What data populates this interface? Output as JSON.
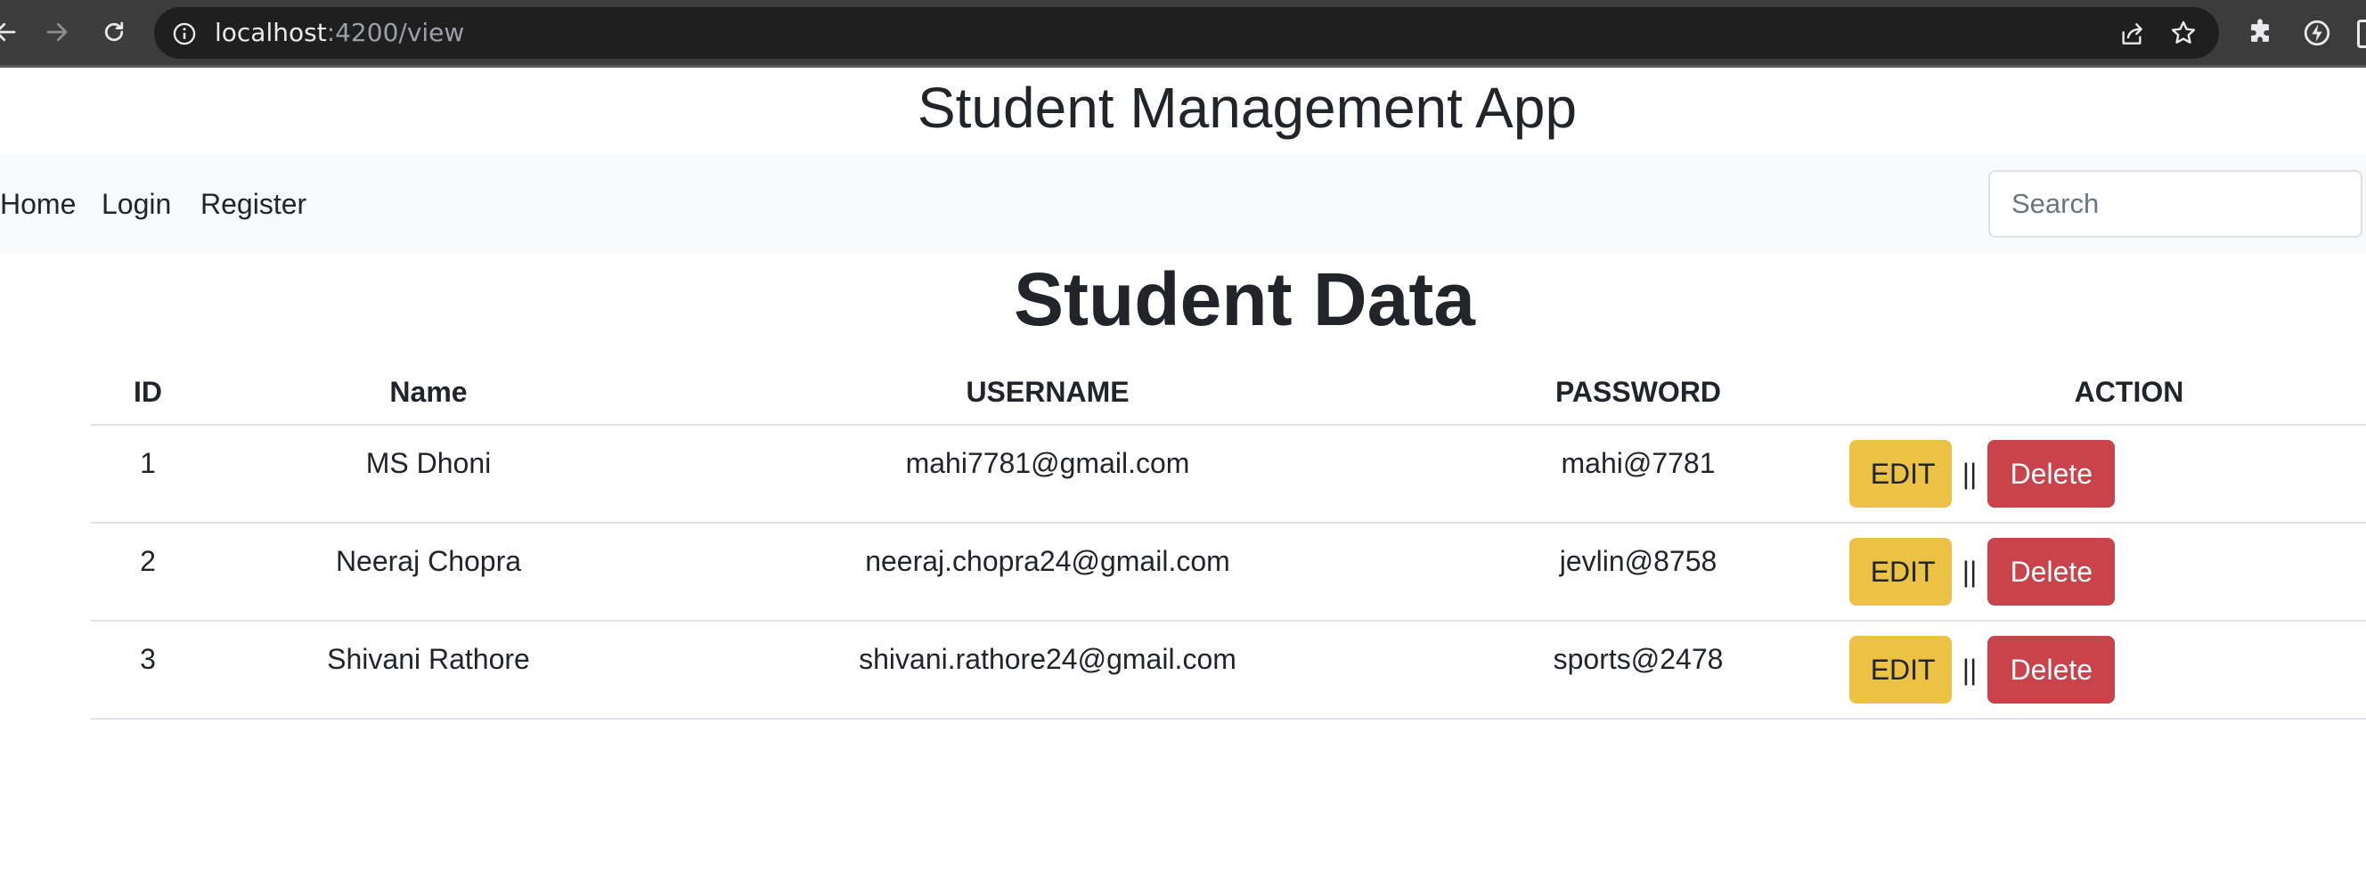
{
  "browser": {
    "url_host": "localhost",
    "url_path": ":4200/view"
  },
  "app": {
    "title": "Student Management App"
  },
  "nav": {
    "links": [
      "Home",
      "Login",
      "Register"
    ],
    "search_placeholder": "Search"
  },
  "page": {
    "title": "Student Data"
  },
  "table": {
    "headers": [
      "ID",
      "Name",
      "USERNAME",
      "PASSWORD",
      "ACTION"
    ],
    "rows": [
      {
        "id": "1",
        "name": "MS Dhoni",
        "username": "mahi7781@gmail.com",
        "password": "mahi@7781"
      },
      {
        "id": "2",
        "name": "Neeraj Chopra",
        "username": "neeraj.chopra24@gmail.com",
        "password": "jevlin@8758"
      },
      {
        "id": "3",
        "name": "Shivani Rathore",
        "username": "shivani.rathore24@gmail.com",
        "password": "sports@2478"
      }
    ],
    "edit_label": "EDIT",
    "separator": "||",
    "delete_label": "Delete"
  },
  "colors": {
    "edit_button": "#ecc245",
    "delete_button": "#c8434a",
    "navbar_bg": "#f8f9fa",
    "chrome_bg": "#3c3c3c"
  },
  "icons": {
    "back": "back-arrow-icon",
    "forward": "forward-arrow-icon",
    "reload": "reload-icon",
    "info": "info-icon",
    "share": "share-icon",
    "bookmark": "star-icon",
    "extensions": "puzzle-icon",
    "performance": "performance-icon"
  }
}
